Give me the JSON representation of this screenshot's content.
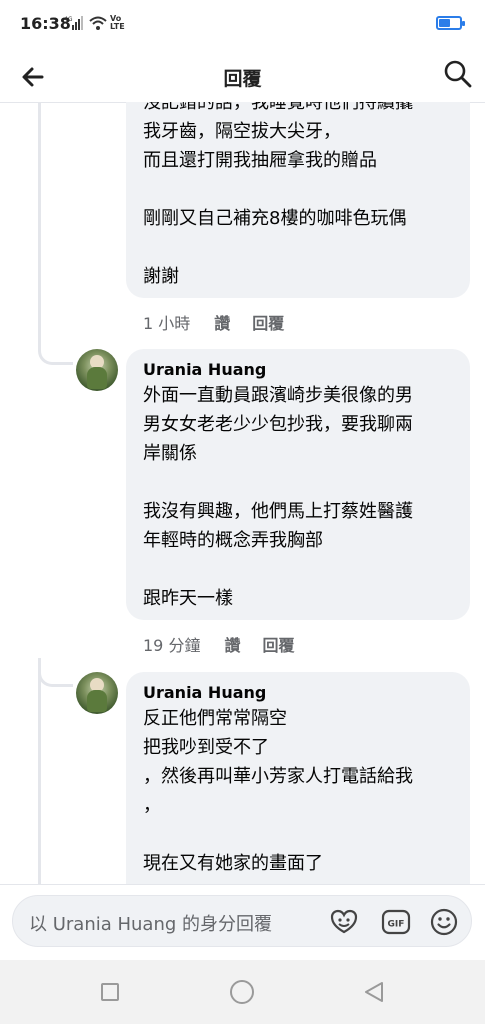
{
  "status_bar": {
    "time": "16:38",
    "network": "4G",
    "volte": [
      "Vo",
      "LTE"
    ],
    "battery_level": 0.55,
    "accent_color": "#2b7de9"
  },
  "header": {
    "title": "回覆",
    "back_icon": "arrow-left-icon",
    "search_icon": "search-icon"
  },
  "comments": [
    {
      "name": "",
      "text": "沒記錯的話，我睡覺時他們持續撬\n我牙齒，隔空拔大尖牙，\n而且還打開我抽屜拿我的贈品\n\n剛剛又自己補充8樓的咖啡色玩偶\n\n謝謝",
      "time": "1 小時",
      "like": "讚",
      "reply": "回覆"
    },
    {
      "name": "Urania Huang",
      "text": "外面一直動員跟濱崎步美很像的男\n男女女老老少少包抄我，要我聊兩\n岸關係\n\n我沒有興趣，他們馬上打蔡姓醫護\n年輕時的概念弄我胸部\n\n跟昨天一樣",
      "time": "19 分鐘",
      "like": "讚",
      "reply": "回覆"
    },
    {
      "name": "Urania Huang",
      "text": "反正他們常常隔空\n把我吵到受不了\n，然後再叫華小芳家人打電話給我\n，\n\n現在又有她家的畫面了"
    }
  ],
  "composer": {
    "placeholder": "以 Urania Huang 的身分回覆",
    "icons": [
      "avatar-sticker-icon",
      "gif-icon",
      "emoji-icon"
    ],
    "gif_label": "GIF"
  },
  "nav_bar": {
    "icons": [
      "recent-apps-icon",
      "home-icon",
      "back-triangle-icon"
    ]
  }
}
